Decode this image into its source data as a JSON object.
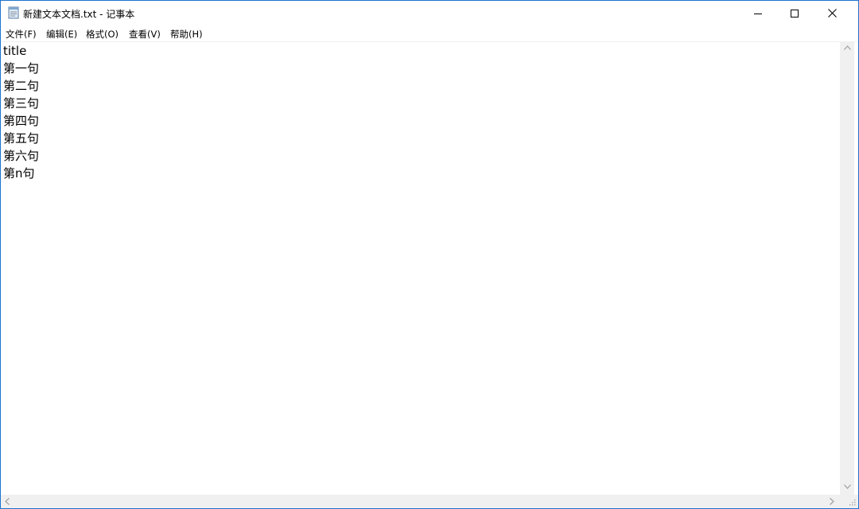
{
  "window": {
    "title": "新建文本文档.txt - 记事本",
    "app_icon": "notepad-icon",
    "controls": {
      "minimize": "minimize-icon",
      "maximize": "maximize-icon",
      "close": "close-icon"
    }
  },
  "menu": {
    "items": [
      {
        "label": "文件(F)"
      },
      {
        "label": "编辑(E)"
      },
      {
        "label": "格式(O)"
      },
      {
        "label": "查看(V)"
      },
      {
        "label": "帮助(H)"
      }
    ]
  },
  "document": {
    "lines": [
      "title",
      "第一句",
      "第二句",
      "第三句",
      "第四句",
      "第五句",
      "第六句",
      "第n句"
    ]
  },
  "colors": {
    "window_border": "#1b75d0",
    "scrollbar": "#f0f0f0",
    "arrow": "#a0a0a0"
  }
}
